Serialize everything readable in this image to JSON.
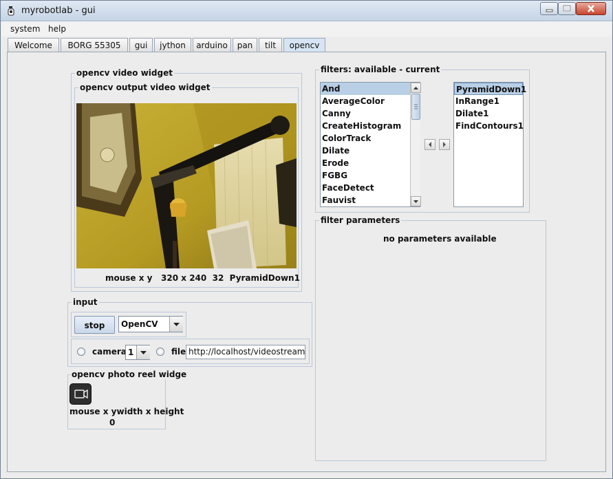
{
  "window": {
    "title": "myrobotlab - gui"
  },
  "menu": [
    "system",
    "help"
  ],
  "tabs": [
    "Welcome",
    "BORG 55305",
    "gui",
    "jython",
    "arduino",
    "pan",
    "tilt",
    "opencv"
  ],
  "active_tab": "opencv",
  "video_widget": {
    "title": "opencv  video widget",
    "output_title": "opencv output video widget",
    "status": {
      "mouse": "mouse x y",
      "size": "320 x 240",
      "count": "32",
      "filter": "PyramidDown1"
    }
  },
  "filters": {
    "title": "filters: available - current",
    "available": [
      "And",
      "AverageColor",
      "Canny",
      "CreateHistogram",
      "ColorTrack",
      "Dilate",
      "Erode",
      "FGBG",
      "FaceDetect",
      "Fauvist"
    ],
    "selected_available": "And",
    "current": [
      "PyramidDown1",
      "InRange1",
      "Dilate1",
      "FindContours1"
    ],
    "selected_current": "PyramidDown1"
  },
  "filter_parameters": {
    "title": "filter parameters",
    "message": "no parameters available"
  },
  "input": {
    "title": "input",
    "stop_label": "stop",
    "grabber_value": "OpenCV",
    "camera_label": "camera",
    "camera_index": "1",
    "file_label": "file",
    "file_value": "http://localhost/videostream.cgi"
  },
  "photo_reel": {
    "title": "opencv  photo reel widge",
    "caption": "mouse x ywidth x height",
    "count": "0"
  }
}
